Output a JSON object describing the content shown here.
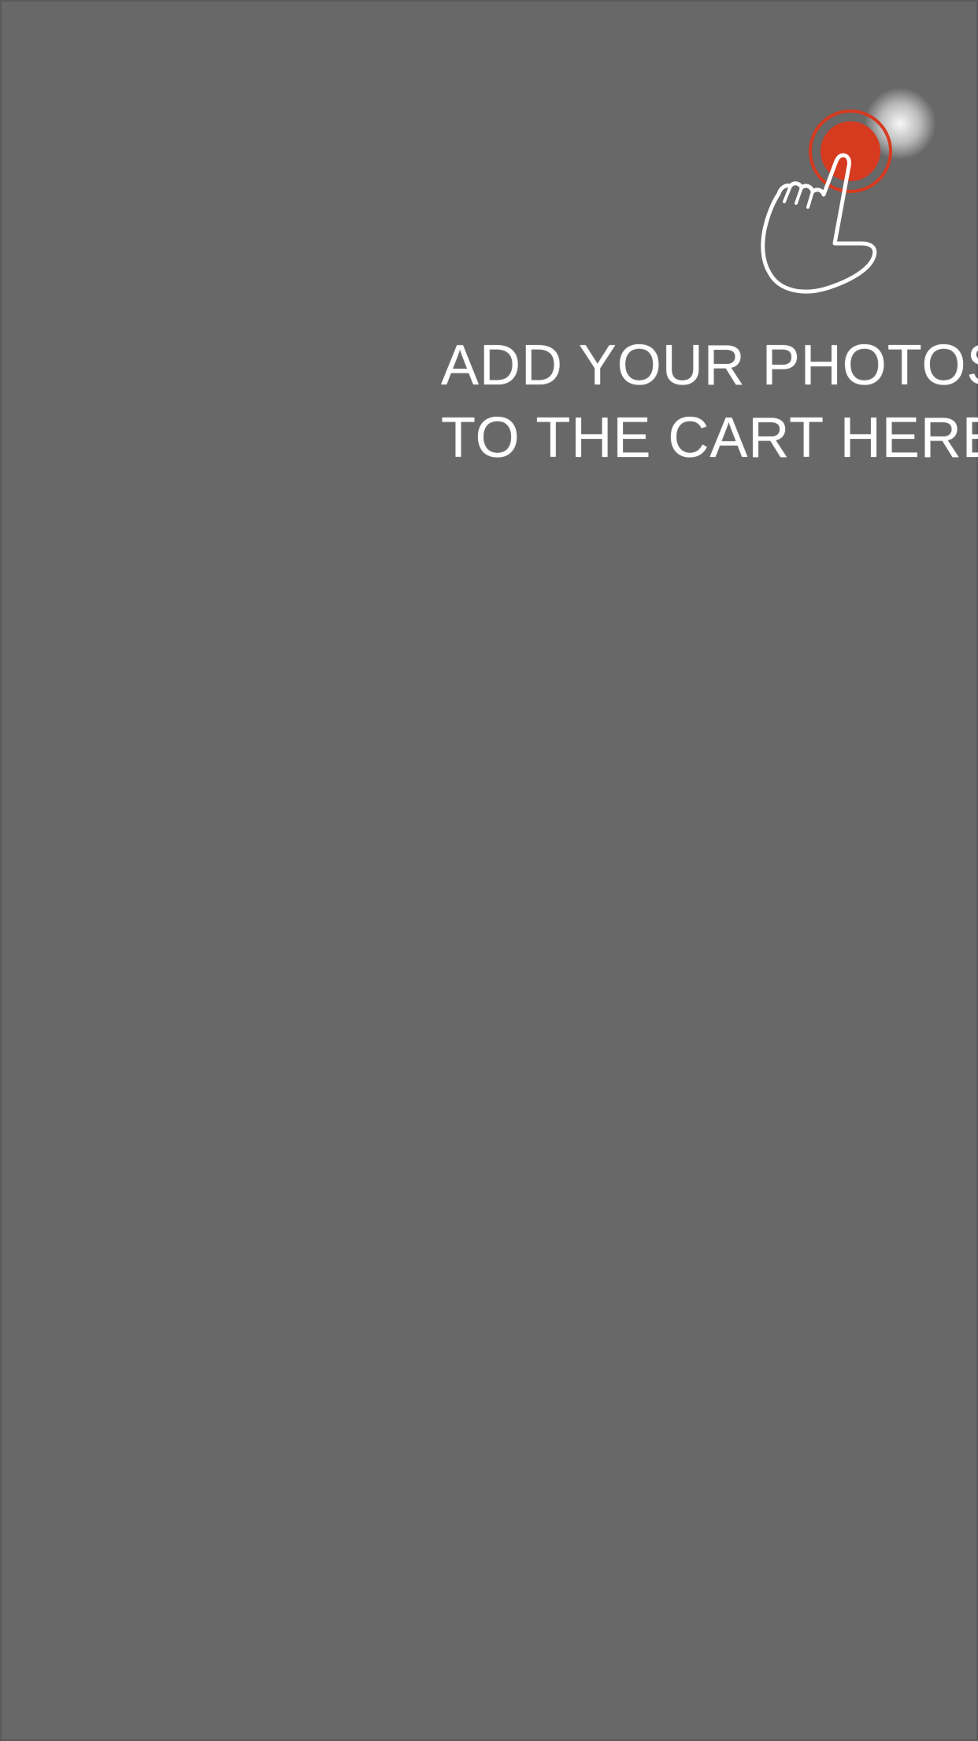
{
  "overlay": {
    "hint": {
      "line1": "ADD YOUR PHOTOS",
      "line2": "TO THE CART HERE",
      "icon": "tap-hand-icon",
      "target_icon": "tap-target-icon",
      "accent_color": "#d63a1f",
      "background_color": "#686868"
    }
  }
}
